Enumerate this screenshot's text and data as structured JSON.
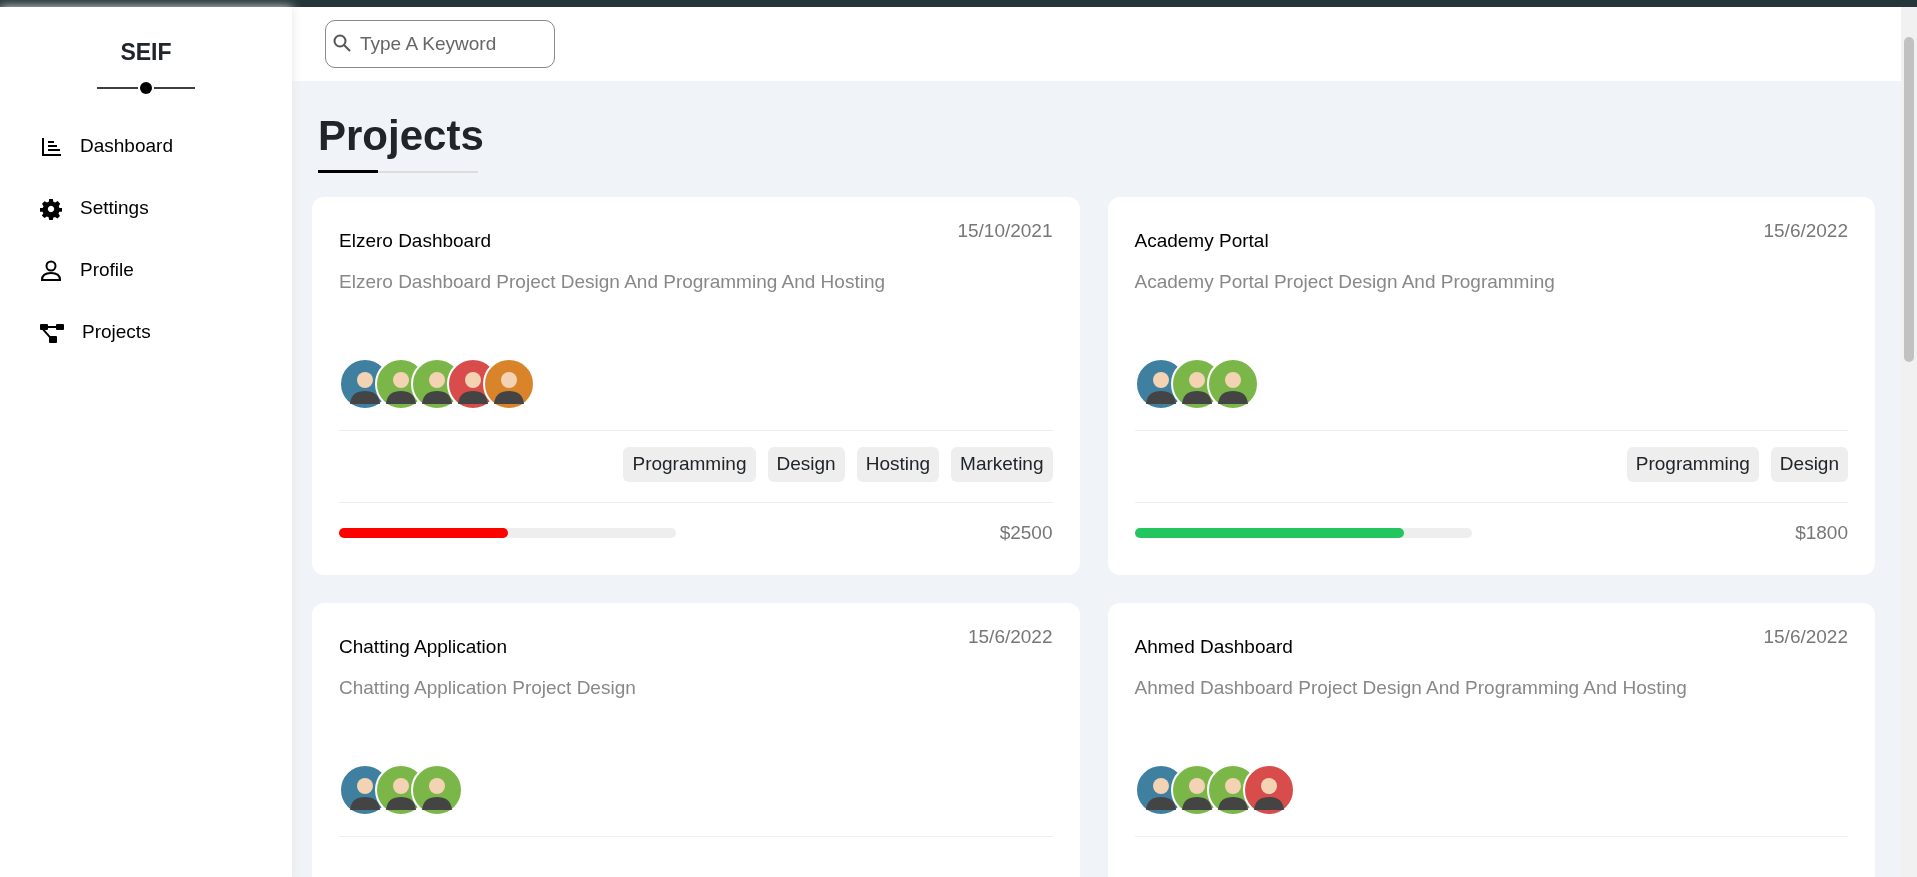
{
  "sidebar": {
    "brand": "SEIF",
    "items": [
      {
        "label": "Dashboard",
        "selected": false
      },
      {
        "label": "Settings",
        "selected": false
      },
      {
        "label": "Profile",
        "selected": false
      },
      {
        "label": "Projects",
        "selected": false
      }
    ]
  },
  "search": {
    "placeholder": "Type A Keyword"
  },
  "page_title": "Projects",
  "projects": [
    {
      "title": "Elzero Dashboard",
      "date": "15/10/2021",
      "description": "Elzero Dashboard Project Design And Programming And Hosting",
      "avatars": [
        {
          "color": "#3f7fa0"
        },
        {
          "color": "#7ab648"
        },
        {
          "color": "#7ab648"
        },
        {
          "color": "#d94c4c"
        },
        {
          "color": "#d9842a"
        }
      ],
      "tags": [
        "Programming",
        "Design",
        "Hosting",
        "Marketing"
      ],
      "progress": {
        "level": 0.5,
        "color": "#ff0000"
      },
      "price": "$2500"
    },
    {
      "title": "Academy Portal",
      "date": "15/6/2022",
      "description": "Academy Portal Project Design And Programming",
      "avatars": [
        {
          "color": "#3f7fa0"
        },
        {
          "color": "#7ab648"
        },
        {
          "color": "#7ab648"
        }
      ],
      "tags": [
        "Programming",
        "Design"
      ],
      "progress": {
        "level": 0.8,
        "color": "#22c55e"
      },
      "price": "$1800"
    },
    {
      "title": "Chatting Application",
      "date": "15/6/2022",
      "description": "Chatting Application Project Design",
      "avatars": [
        {
          "color": "#3f7fa0"
        },
        {
          "color": "#7ab648"
        },
        {
          "color": "#7ab648"
        }
      ]
    },
    {
      "title": "Ahmed Dashboard",
      "date": "15/6/2022",
      "description": "Ahmed Dashboard Project Design And Programming And Hosting",
      "avatars": [
        {
          "color": "#3f7fa0"
        },
        {
          "color": "#7ab648"
        },
        {
          "color": "#7ab648"
        },
        {
          "color": "#d94c4c"
        }
      ]
    }
  ]
}
